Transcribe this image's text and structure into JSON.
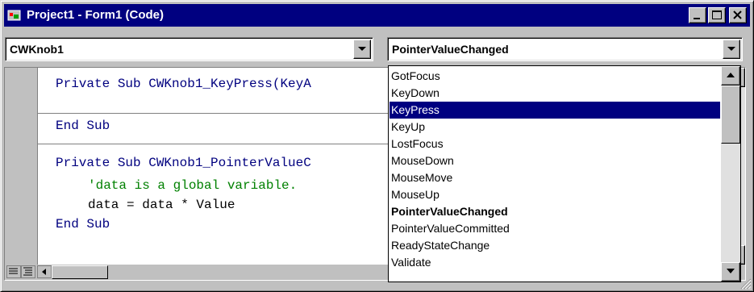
{
  "window": {
    "title": "Project1 - Form1 (Code)"
  },
  "object_combo": {
    "value": "CWKnob1"
  },
  "procedure_combo": {
    "value": "PointerValueChanged"
  },
  "code_lines": [
    "Private Sub CWKnob1_KeyPress(KeyA",
    "End Sub",
    "Private Sub CWKnob1_PointerValueC",
    "'data is a global variable.",
    "data = data * Value",
    "End Sub"
  ],
  "event_list": {
    "items": [
      "GotFocus",
      "KeyDown",
      "KeyPress",
      "KeyUp",
      "LostFocus",
      "MouseDown",
      "MouseMove",
      "MouseUp",
      "PointerValueChanged",
      "PointerValueCommitted",
      "ReadyStateChange",
      "Validate"
    ],
    "highlighted": "KeyPress",
    "bold_item": "PointerValueChanged"
  },
  "colors": {
    "titlebar": "#000080",
    "keyword": "#00007f",
    "comment": "#008000",
    "selection": "#000080"
  }
}
